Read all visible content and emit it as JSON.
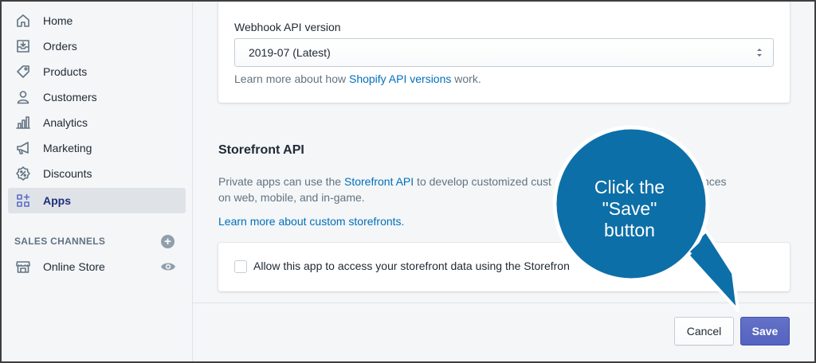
{
  "sidebar": {
    "items": [
      {
        "label": "Home",
        "icon": "home-icon",
        "active": false
      },
      {
        "label": "Orders",
        "icon": "orders-icon",
        "active": false
      },
      {
        "label": "Products",
        "icon": "tag-icon",
        "active": false
      },
      {
        "label": "Customers",
        "icon": "person-icon",
        "active": false
      },
      {
        "label": "Analytics",
        "icon": "bar-chart-icon",
        "active": false
      },
      {
        "label": "Marketing",
        "icon": "megaphone-icon",
        "active": false
      },
      {
        "label": "Discounts",
        "icon": "discount-icon",
        "active": false
      },
      {
        "label": "Apps",
        "icon": "apps-icon",
        "active": true
      }
    ],
    "sales_channels_title": "SALES CHANNELS",
    "online_store_label": "Online Store"
  },
  "webhook": {
    "label": "Webhook API version",
    "selected": "2019-07 (Latest)",
    "help_prefix": "Learn more about how ",
    "help_link": "Shopify API versions",
    "help_suffix": " work."
  },
  "storefront": {
    "title": "Storefront API",
    "desc_prefix": "Private apps can use the ",
    "desc_link": "Storefront API",
    "desc_visible_1": " to develop customized cust",
    "desc_visible_2": "nces",
    "desc_line2": "on web, mobile, and in-game.",
    "learn_link": "Learn more about custom storefronts.",
    "checkbox_label": "Allow this app to access your storefront data using the Storefron",
    "checkbox_checked": false
  },
  "footer": {
    "cancel_label": "Cancel",
    "save_label": "Save"
  },
  "callout": {
    "line1": "Click the",
    "line2": "\"Save\"",
    "line3": "button",
    "color": "#0d6fa8"
  },
  "colors": {
    "primary": "#5c6ac4",
    "link": "#006fbb",
    "active_nav": "#202e78"
  }
}
